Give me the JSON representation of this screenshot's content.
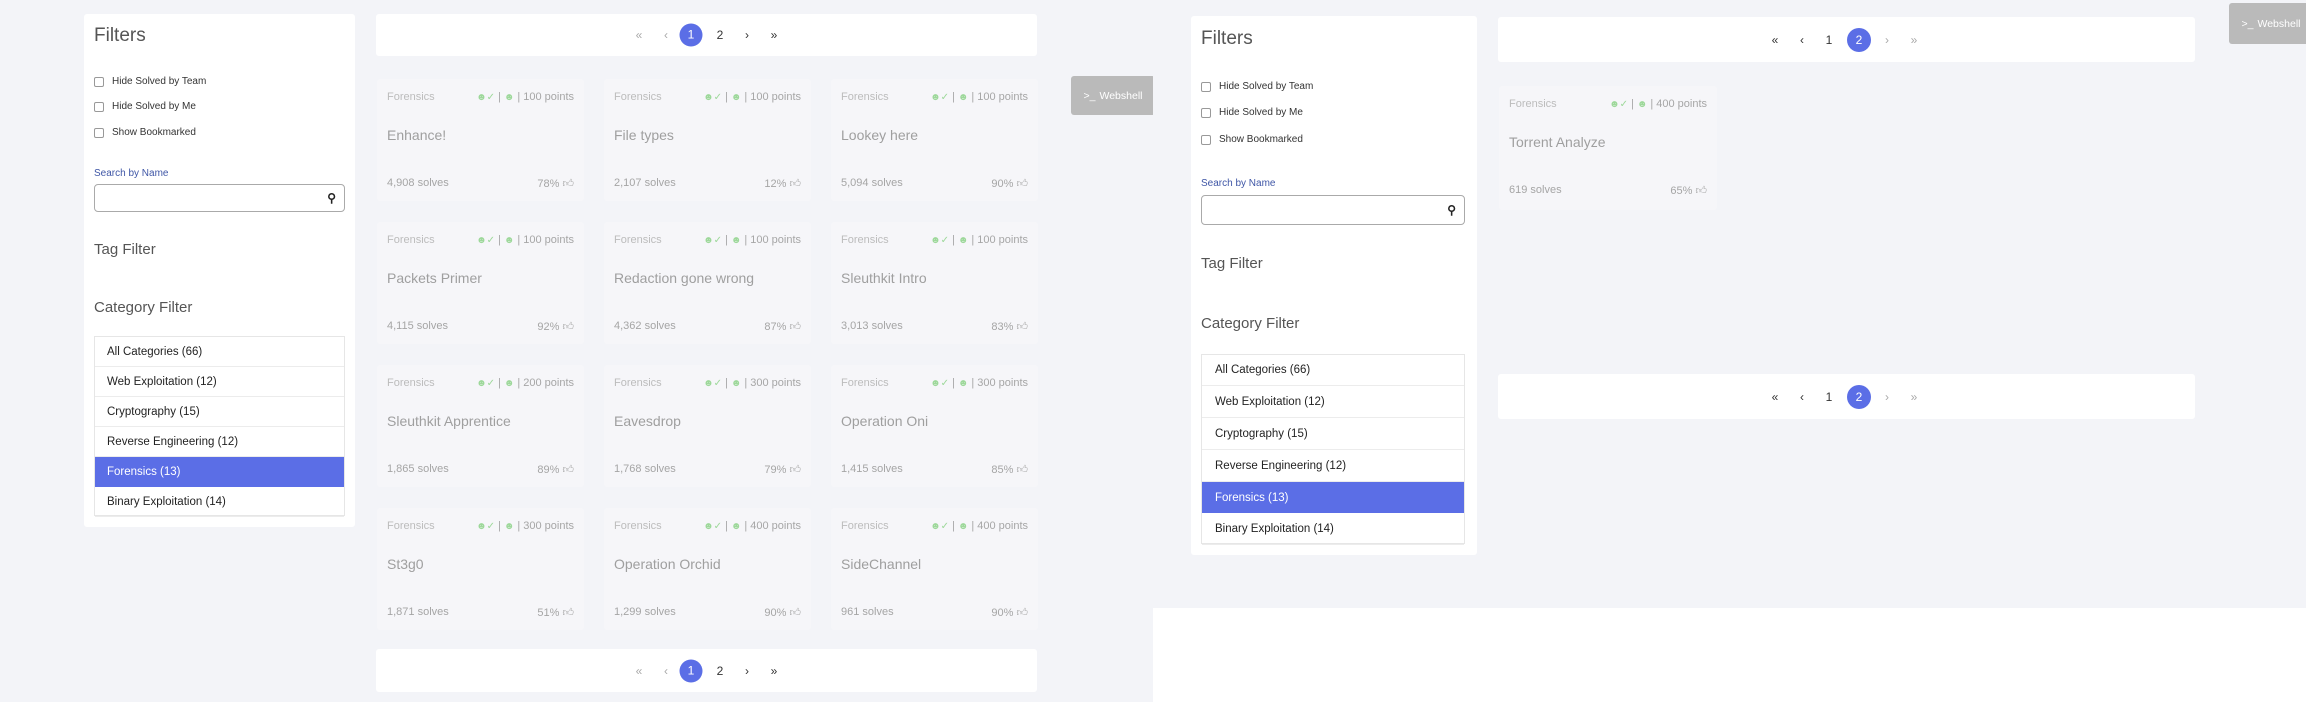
{
  "left": {
    "filters": {
      "title": "Filters",
      "checkboxes": [
        "Hide Solved by Team",
        "Hide Solved by Me",
        "Show Bookmarked"
      ],
      "search_label": "Search by Name",
      "search_value": "",
      "tag_filter": "Tag Filter",
      "category_filter": "Category Filter",
      "categories": [
        "All Categories  (66)",
        "Web Exploitation (12)",
        "Cryptography (15)",
        "Reverse Engineering (12)",
        "Forensics (13)",
        "Binary Exploitation (14)"
      ],
      "active_category": "Forensics (13)"
    },
    "pagination": {
      "first": "«",
      "prev": "‹",
      "p1": "1",
      "p2": "2",
      "next": "›",
      "last": "»",
      "current": "1"
    },
    "challenges": [
      {
        "category": "Forensics",
        "points": "100 points",
        "name": "Enhance!",
        "solves": "4,908 solves",
        "rating": "78%"
      },
      {
        "category": "Forensics",
        "points": "100 points",
        "name": "File types",
        "solves": "2,107 solves",
        "rating": "12%"
      },
      {
        "category": "Forensics",
        "points": "100 points",
        "name": "Lookey here",
        "solves": "5,094 solves",
        "rating": "90%"
      },
      {
        "category": "Forensics",
        "points": "100 points",
        "name": "Packets Primer",
        "solves": "4,115 solves",
        "rating": "92%"
      },
      {
        "category": "Forensics",
        "points": "100 points",
        "name": "Redaction gone wrong",
        "solves": "4,362 solves",
        "rating": "87%"
      },
      {
        "category": "Forensics",
        "points": "100 points",
        "name": "Sleuthkit Intro",
        "solves": "3,013 solves",
        "rating": "83%"
      },
      {
        "category": "Forensics",
        "points": "200 points",
        "name": "Sleuthkit Apprentice",
        "solves": "1,865 solves",
        "rating": "89%"
      },
      {
        "category": "Forensics",
        "points": "300 points",
        "name": "Eavesdrop",
        "solves": "1,768 solves",
        "rating": "79%"
      },
      {
        "category": "Forensics",
        "points": "300 points",
        "name": "Operation Oni",
        "solves": "1,415 solves",
        "rating": "85%"
      },
      {
        "category": "Forensics",
        "points": "300 points",
        "name": "St3g0",
        "solves": "1,871 solves",
        "rating": "51%"
      },
      {
        "category": "Forensics",
        "points": "400 points",
        "name": "Operation Orchid",
        "solves": "1,299 solves",
        "rating": "90%"
      },
      {
        "category": "Forensics",
        "points": "400 points",
        "name": "SideChannel",
        "solves": "961 solves",
        "rating": "90%"
      }
    ],
    "webshell": "Webshell"
  },
  "right": {
    "filters": {
      "title": "Filters",
      "checkboxes": [
        "Hide Solved by Team",
        "Hide Solved by Me",
        "Show Bookmarked"
      ],
      "search_label": "Search by Name",
      "search_value": "",
      "tag_filter": "Tag Filter",
      "category_filter": "Category Filter",
      "categories": [
        "All Categories  (66)",
        "Web Exploitation (12)",
        "Cryptography (15)",
        "Reverse Engineering (12)",
        "Forensics (13)",
        "Binary Exploitation (14)"
      ],
      "active_category": "Forensics (13)"
    },
    "pagination": {
      "first": "«",
      "prev": "‹",
      "p1": "1",
      "p2": "2",
      "next": "›",
      "last": "»",
      "current": "2"
    },
    "challenges": [
      {
        "category": "Forensics",
        "points": "400 points",
        "name": "Torrent Analyze",
        "solves": "619 solves",
        "rating": "65%"
      }
    ],
    "webshell": "Webshell"
  },
  "icons": {
    "search": "search-icon",
    "user_check": "user-check-icon",
    "user": "user-icon",
    "thumbs_up": "thumbs-up-icon",
    "terminal": "terminal-icon"
  },
  "colors": {
    "accent": "#5b6ee6",
    "solved_icon": "#9dd89a",
    "webshell": "#bababa"
  }
}
